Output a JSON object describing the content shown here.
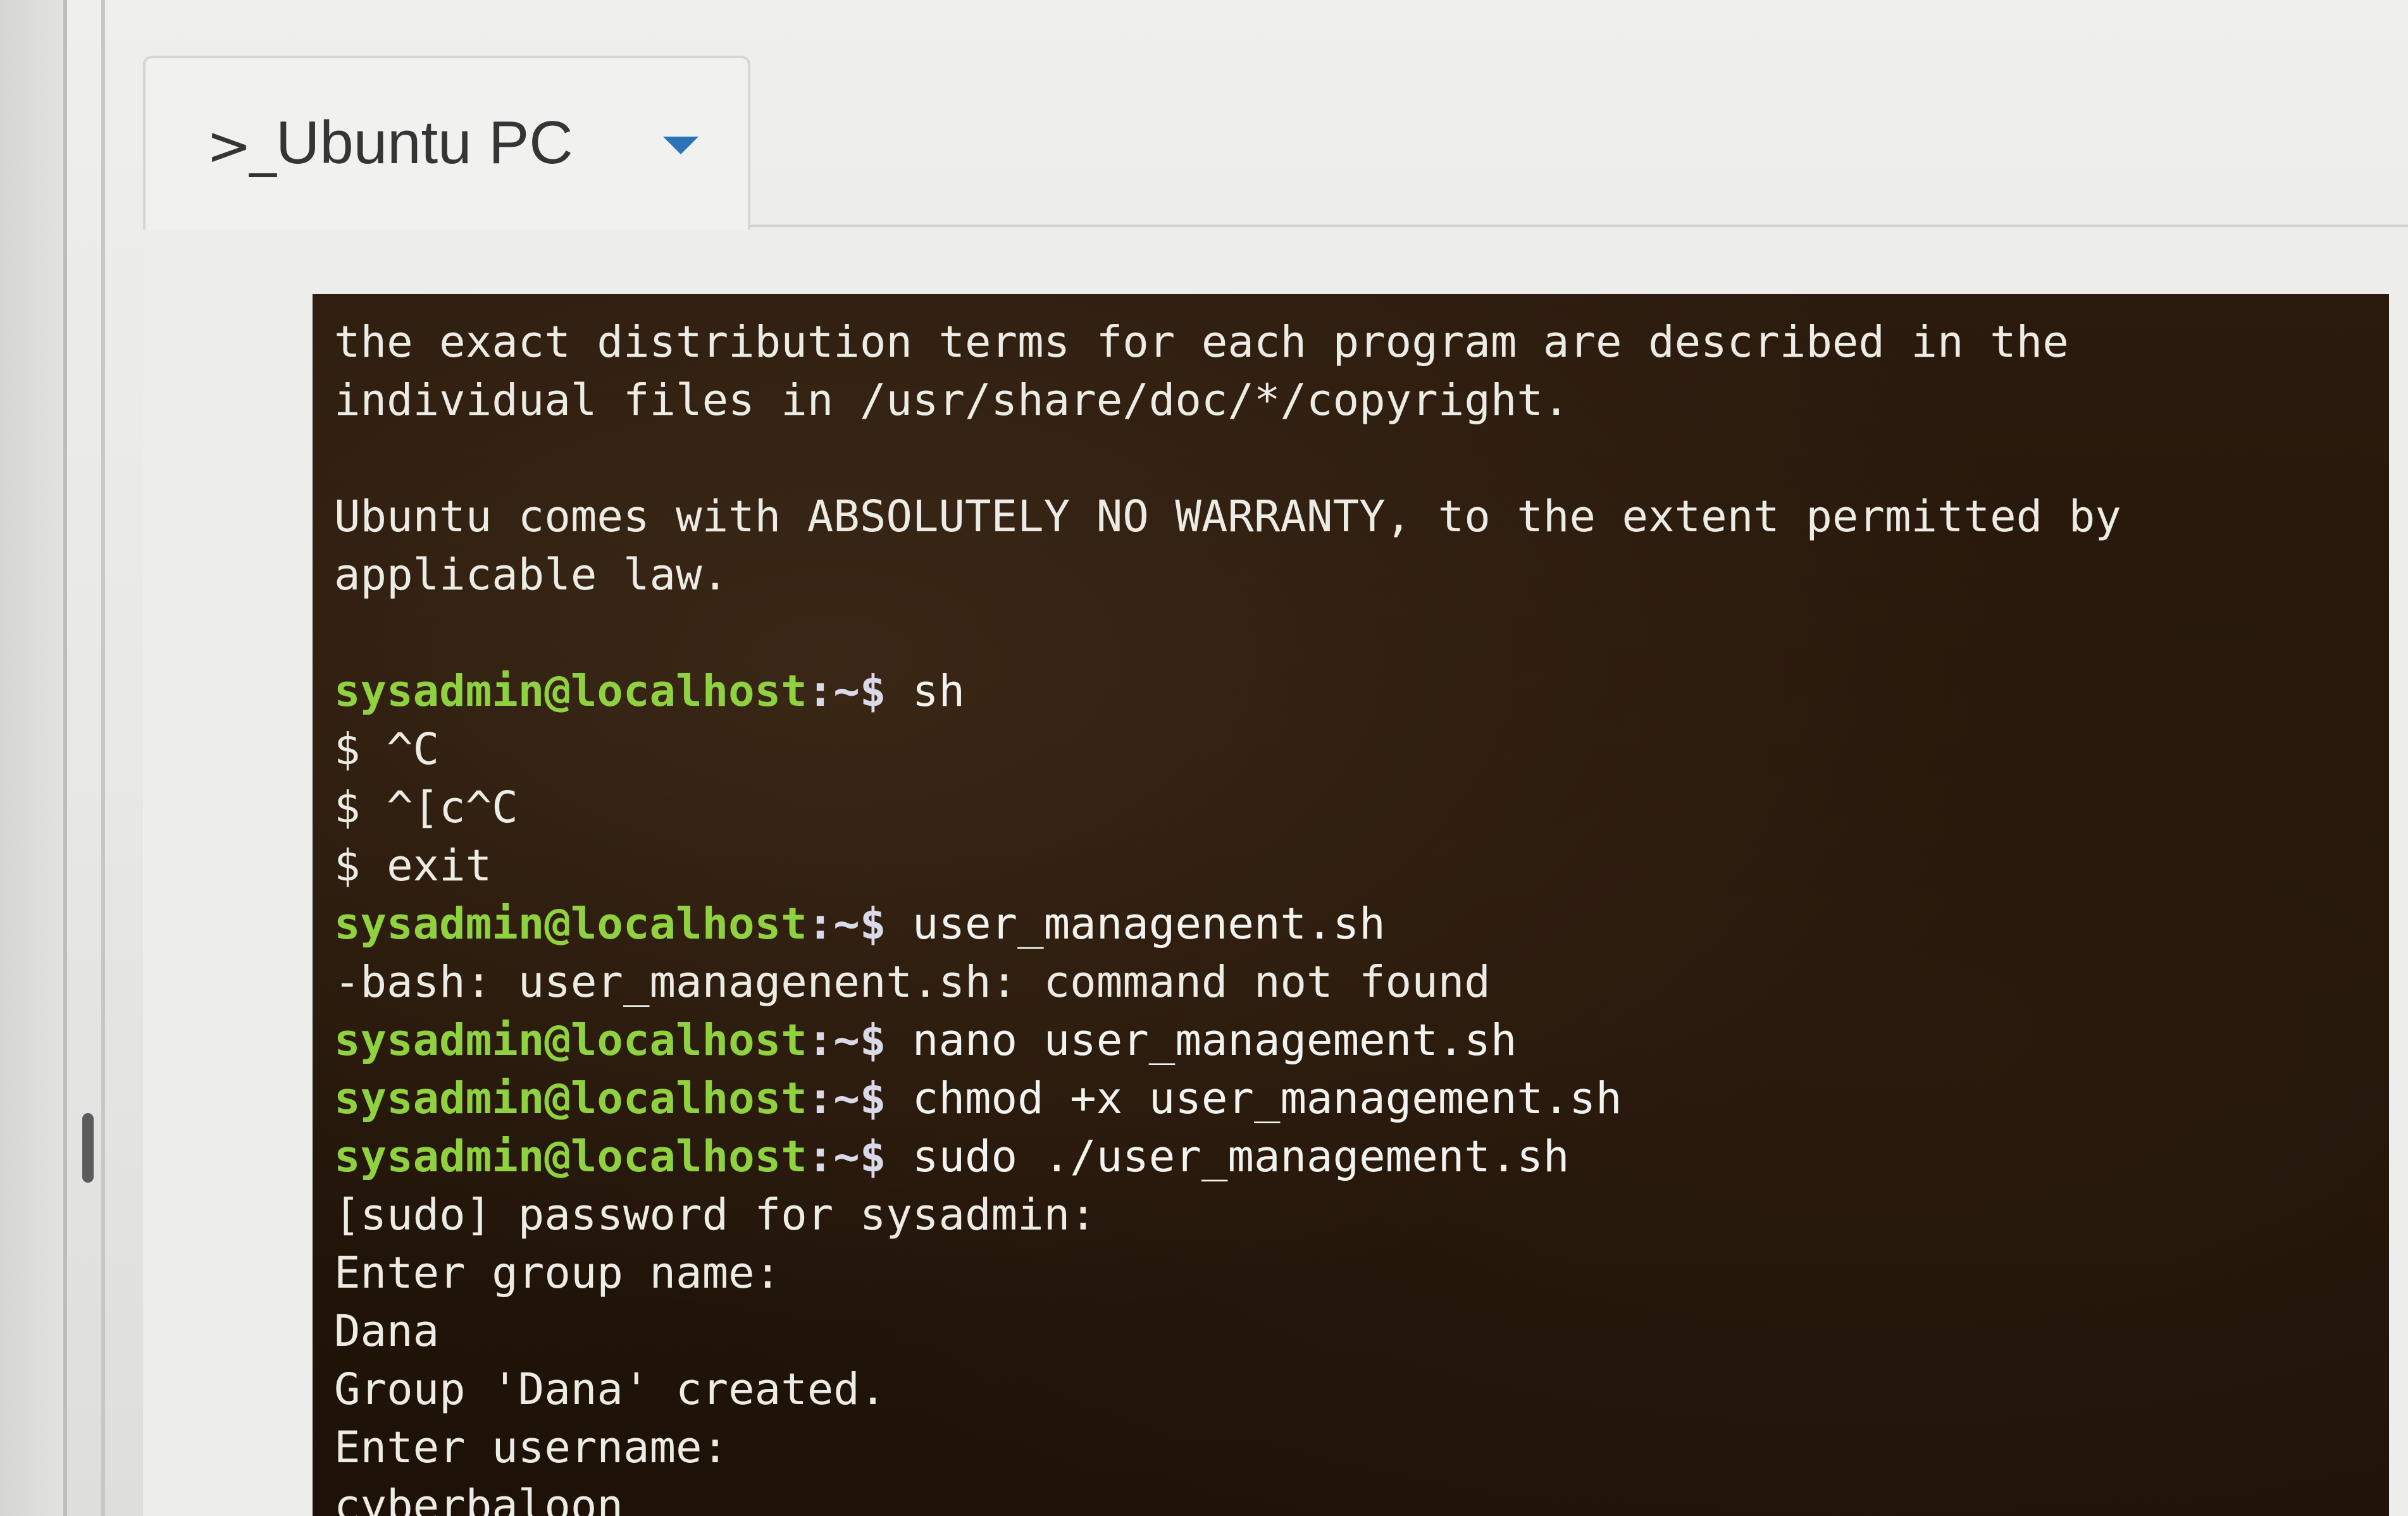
{
  "tab": {
    "icon": "terminal-prompt-icon",
    "icon_glyph": ">_",
    "label": "Ubuntu PC",
    "caret_icon": "caret-down-icon"
  },
  "colors": {
    "prompt_green": "#8fd13f",
    "terminal_bg": "#2b1b0e",
    "terminal_text": "#ecebe4",
    "tab_caret": "#2a73b8"
  },
  "terminal": {
    "lines": [
      {
        "type": "output",
        "text": "the exact distribution terms for each program are described in the"
      },
      {
        "type": "output",
        "text": "individual files in /usr/share/doc/*/copyright."
      },
      {
        "type": "blank",
        "text": ""
      },
      {
        "type": "output",
        "text": "Ubuntu comes with ABSOLUTELY NO WARRANTY, to the extent permitted by"
      },
      {
        "type": "output",
        "text": "applicable law."
      },
      {
        "type": "blank",
        "text": ""
      },
      {
        "type": "prompt",
        "user_host": "sysadmin@localhost",
        "path": ":~$",
        "command": " sh"
      },
      {
        "type": "output",
        "text": "$ ^C"
      },
      {
        "type": "output",
        "text": "$ ^[c^C"
      },
      {
        "type": "output",
        "text": "$ exit"
      },
      {
        "type": "prompt",
        "user_host": "sysadmin@localhost",
        "path": ":~$",
        "command": " user_managenent.sh"
      },
      {
        "type": "output",
        "text": "-bash: user_managenent.sh: command not found"
      },
      {
        "type": "prompt",
        "user_host": "sysadmin@localhost",
        "path": ":~$",
        "command": " nano user_management.sh"
      },
      {
        "type": "prompt",
        "user_host": "sysadmin@localhost",
        "path": ":~$",
        "command": " chmod +x user_management.sh"
      },
      {
        "type": "prompt",
        "user_host": "sysadmin@localhost",
        "path": ":~$",
        "command": " sudo ./user_management.sh"
      },
      {
        "type": "output",
        "text": "[sudo] password for sysadmin:"
      },
      {
        "type": "output",
        "text": "Enter group name:"
      },
      {
        "type": "output",
        "text": "Dana"
      },
      {
        "type": "output",
        "text": "Group 'Dana' created."
      },
      {
        "type": "output",
        "text": "Enter username:"
      },
      {
        "type": "output",
        "text": "cyberbaloon"
      }
    ]
  }
}
